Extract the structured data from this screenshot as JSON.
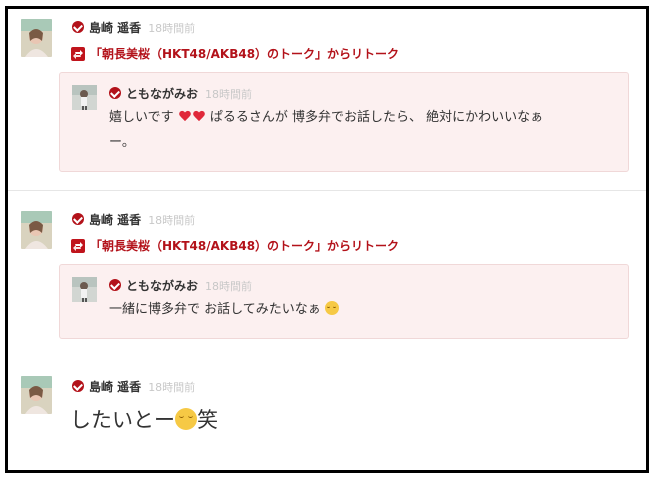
{
  "posts": [
    {
      "author": "島崎 遥香",
      "time": "18時間前",
      "retalk": "「朝長美桜（HKT48/AKB48）のトーク」からリトーク",
      "quote": {
        "author": "ともながみお",
        "time": "18時間前",
        "text_a": "嬉しいです",
        "text_b": "ぱるるさんが 博多弁でお話したら、 絶対にかわいいなぁ",
        "text_c": "ー。"
      }
    },
    {
      "author": "島崎 遥香",
      "time": "18時間前",
      "retalk": "「朝長美桜（HKT48/AKB48）のトーク」からリトーク",
      "quote": {
        "author": "ともながみお",
        "time": "18時間前",
        "text_a": "一緒に博多弁で お話してみたいなぁ"
      }
    },
    {
      "author": "島崎 遥香",
      "time": "18時間前",
      "text_a": "したいとー",
      "text_b": "笑"
    }
  ],
  "colors": {
    "brand_red": "#b3121a",
    "quote_bg": "#fcf0f0",
    "time_gray": "#c8c8c8"
  },
  "icons": [
    "verified-check-icon",
    "retalk-icon",
    "heart-emoji-icon",
    "smile-emoji-icon"
  ]
}
